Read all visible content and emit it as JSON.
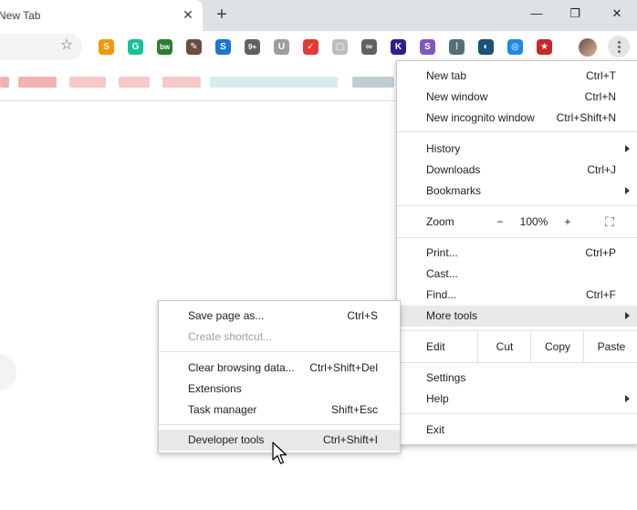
{
  "tab": {
    "title": "New Tab",
    "close": "✕"
  },
  "newtab": "+",
  "window": {
    "minimize": "—",
    "restore": "❐",
    "close": "✕"
  },
  "toolbar": {
    "bookmark_star": "☆",
    "extensions": [
      {
        "name": "sibling-ext",
        "glyph": "S",
        "color": "#f29900"
      },
      {
        "name": "grammarly-ext",
        "glyph": "G",
        "color": "#15c39a"
      },
      {
        "name": "bw-ext",
        "glyph": "bw",
        "color": "#2e7d32"
      },
      {
        "name": "eyedropper-ext",
        "glyph": "✎",
        "color": "#6d4c41"
      },
      {
        "name": "s-ext",
        "glyph": "S",
        "color": "#1976d2"
      },
      {
        "name": "badge-ext",
        "glyph": "9+",
        "color": "#5f6368"
      },
      {
        "name": "u-ext",
        "glyph": "U",
        "color": "#9e9e9e"
      },
      {
        "name": "todo-ext",
        "glyph": "✓",
        "color": "#e53935"
      },
      {
        "name": "square-ext",
        "glyph": "▢",
        "color": "#bdbdbd"
      },
      {
        "name": "link-ext",
        "glyph": "∞",
        "color": "#616161"
      },
      {
        "name": "k-ext",
        "glyph": "K",
        "color": "#311b92"
      },
      {
        "name": "s2-ext",
        "glyph": "S",
        "color": "#7e57c2"
      },
      {
        "name": "dots-ext",
        "glyph": "⁞",
        "color": "#546e7a"
      },
      {
        "name": "globe-ext",
        "glyph": "◐",
        "color": "#1a5276"
      },
      {
        "name": "headphones-ext",
        "glyph": "◎",
        "color": "#1e88e5"
      },
      {
        "name": "star-ext",
        "glyph": "★",
        "color": "#c62828"
      }
    ]
  },
  "main_menu": {
    "items": [
      {
        "label": "New tab",
        "shortcut": "Ctrl+T"
      },
      {
        "label": "New window",
        "shortcut": "Ctrl+N"
      },
      {
        "label": "New incognito window",
        "shortcut": "Ctrl+Shift+N"
      },
      {
        "label": "History",
        "shortcut": ""
      },
      {
        "label": "Downloads",
        "shortcut": "Ctrl+J"
      },
      {
        "label": "Bookmarks",
        "shortcut": ""
      },
      {
        "label": "Print...",
        "shortcut": "Ctrl+P"
      },
      {
        "label": "Cast...",
        "shortcut": ""
      },
      {
        "label": "Find...",
        "shortcut": "Ctrl+F"
      },
      {
        "label": "More tools",
        "shortcut": ""
      },
      {
        "label": "Settings",
        "shortcut": ""
      },
      {
        "label": "Help",
        "shortcut": ""
      },
      {
        "label": "Exit",
        "shortcut": ""
      }
    ],
    "zoom": {
      "label": "Zoom",
      "minus": "−",
      "value": "100%",
      "plus": "+",
      "fullscreen": "⛶"
    },
    "edit": {
      "label": "Edit",
      "cut": "Cut",
      "copy": "Copy",
      "paste": "Paste"
    }
  },
  "submenu": {
    "items": [
      {
        "label": "Save page as...",
        "shortcut": "Ctrl+S"
      },
      {
        "label": "Create shortcut...",
        "shortcut": ""
      },
      {
        "label": "Clear browsing data...",
        "shortcut": "Ctrl+Shift+Del"
      },
      {
        "label": "Extensions",
        "shortcut": ""
      },
      {
        "label": "Task manager",
        "shortcut": "Shift+Esc"
      },
      {
        "label": "Developer tools",
        "shortcut": "Ctrl+Shift+I"
      }
    ]
  }
}
